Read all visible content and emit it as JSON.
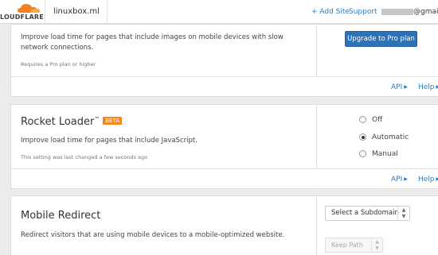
{
  "header": {
    "logo_text": "LOUDFLARE",
    "site_name": "linuxbox.ml",
    "add_site": "+ Add Site",
    "support": "Support",
    "email_suffix": "@gmail.a"
  },
  "cards": {
    "polish": {
      "description": "Improve load time for pages that include images on mobile devices with slow network connections.",
      "note": "Requires a Pro plan or higher",
      "upgrade_button": "Upgrade to Pro plan",
      "api_link": "API",
      "help_link": "Help"
    },
    "rocket_loader": {
      "title": "Rocket Loader",
      "trademark": "™",
      "badge": "BETA",
      "description": "Improve load time for pages that include JavaScript.",
      "note": "This setting was last changed a few seconds ago",
      "options": [
        {
          "label": "Off",
          "selected": false
        },
        {
          "label": "Automatic",
          "selected": true
        },
        {
          "label": "Manual",
          "selected": false
        }
      ],
      "api_link": "API",
      "help_link": "Help"
    },
    "mobile_redirect": {
      "title": "Mobile Redirect",
      "description": "Redirect visitors that are using mobile devices to a mobile-optimized website.",
      "subdomain_select": "Select a Subdomain",
      "keep_path": "Keep Path"
    }
  },
  "colors": {
    "link": "#2f7bbf",
    "primary_button": "#2b72b9",
    "beta_badge": "#f08a24",
    "logo_orange": "#f38020"
  }
}
